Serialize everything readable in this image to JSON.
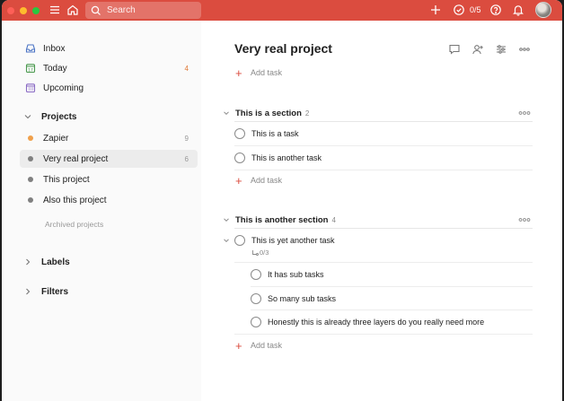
{
  "topbar": {
    "search_placeholder": "Search",
    "karma": "0/5"
  },
  "sidebar": {
    "nav": [
      {
        "label": "Inbox",
        "count": ""
      },
      {
        "label": "Today",
        "count": "4"
      },
      {
        "label": "Upcoming",
        "count": ""
      }
    ],
    "projects_heading": "Projects",
    "projects": [
      {
        "label": "Zapier",
        "count": "9",
        "color": "#f0a04b"
      },
      {
        "label": "Very real project",
        "count": "6",
        "color": "#808080"
      },
      {
        "label": "This project",
        "count": "",
        "color": "#808080"
      },
      {
        "label": "Also this project",
        "count": "",
        "color": "#808080"
      }
    ],
    "archived": "Archived projects",
    "labels_heading": "Labels",
    "filters_heading": "Filters"
  },
  "main": {
    "title": "Very real project",
    "add_task": "Add task",
    "sections": [
      {
        "name": "This is a section",
        "count": "2",
        "tasks": [
          "This is a task",
          "This is another task"
        ]
      },
      {
        "name": "This is another section",
        "count": "4",
        "parent_task": "This is yet another task",
        "subtask_progress": "0/3",
        "subtasks": [
          "It has sub tasks",
          "So many sub tasks",
          "Honestly this is already three layers do you really need more"
        ]
      }
    ]
  },
  "colors": {
    "accent": "#db4c3f",
    "sidebar_bg": "#fafafa",
    "today_count": "#e07a39"
  }
}
